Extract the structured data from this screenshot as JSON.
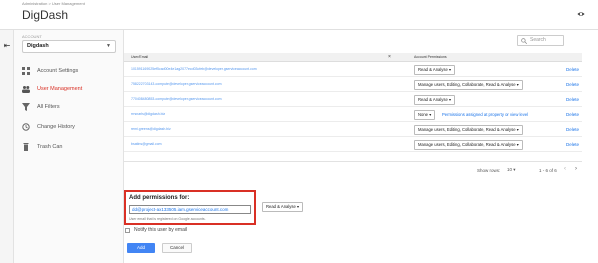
{
  "header": {
    "breadcrumb": "Administration > User Management",
    "title": "DigDash"
  },
  "sidebar": {
    "account_label": "ACCOUNT",
    "account_value": "Digdash",
    "items": [
      {
        "label": "Account Settings",
        "icon": "grid-icon"
      },
      {
        "label": "User Management",
        "icon": "people-icon",
        "active": true
      },
      {
        "label": "All Filters",
        "icon": "filter-icon"
      },
      {
        "label": "Change History",
        "icon": "history-icon"
      },
      {
        "label": "Trash Can",
        "icon": "trash-icon"
      }
    ]
  },
  "search": {
    "placeholder": "Search"
  },
  "table": {
    "col_email": "User/Email",
    "col_permissions": "Account Permissions",
    "rows": [
      {
        "email": "101591169025ef5cad00e4e1ag2077ecd03cfeb@developer.gserviceaccount.com",
        "permission": "Read & Analyse",
        "delete": "Delete"
      },
      {
        "email": "758222703143-compute@developer.gserviceaccount.com",
        "permission": "Manage users, Editing, Collaborate, Read & Analyse",
        "delete": "Delete"
      },
      {
        "email": "770408480853-compute@developer.gserviceaccount.com",
        "permission": "Read & Analyse",
        "delete": "Delete"
      },
      {
        "email": "rrrsnarls@digdash.biz",
        "permission": "None",
        "note": "Permissions assigned at property or view level",
        "delete": "Delete"
      },
      {
        "email": "remi.greens@digdash.biz",
        "permission": "Manage users, Editing, Collaborate, Read & Analyse",
        "delete": "Delete"
      },
      {
        "email": "bsatins@gmail.com",
        "permission": "Manage users, Editing, Collaborate, Read & Analyse",
        "delete": "Delete"
      }
    ]
  },
  "pager": {
    "show_rows_label": "Show rows:",
    "rows_per_page": "10",
    "range": "1 - 6 of 6",
    "prev": "‹",
    "next": "›"
  },
  "add": {
    "title": "Add permissions for:",
    "input_value": "dd@project-ax133505.iam.gserviceaccount.com",
    "hint": "User email that is registered on Google accounts.",
    "permission": "Read & Analyse",
    "notify_label": "Notify this user by email",
    "add_button": "Add",
    "cancel_button": "Cancel"
  },
  "colors": {
    "accent": "#4285f4",
    "active_nav": "#d93025",
    "highlight_border": "#d93025",
    "link": "#1a73e8"
  }
}
